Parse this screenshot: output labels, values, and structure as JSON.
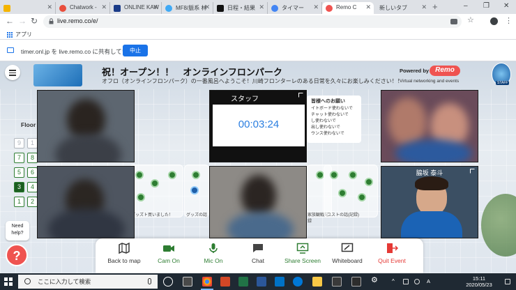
{
  "browser": {
    "tabs": [
      {
        "label": "",
        "favicon_color": "#f4b400"
      },
      {
        "label": "Chatwork - ",
        "favicon_color": "#e94e3c"
      },
      {
        "label": "ONLINE KAW",
        "favicon_color": "#1a3b88"
      },
      {
        "label": "MF8/脈系 林",
        "favicon_color": "#3fa9f5"
      },
      {
        "label": "日程・結果",
        "favicon_color": "#111111"
      },
      {
        "label": "タイマー",
        "favicon_color": "#4285f4"
      },
      {
        "label": "Remo C",
        "favicon_color": "#ef5350"
      },
      {
        "label": "新しいタブ",
        "favicon_color": ""
      }
    ],
    "new_tab_symbol": "+",
    "window_controls": {
      "minimize": "–",
      "maximize": "❐",
      "close": "✕"
    },
    "url": "live.remo.co/e/",
    "bookmarks_apps": "アプリ",
    "share_notice": "timer.onl.jp を live.remo.co に共有しています",
    "stop_share": "中止"
  },
  "remo": {
    "banner_title": "祝！オープン！！　オンラインフロンパーク",
    "banner_subtitle": "オフロ（オンラインフロンパーク）の一番風呂へようこそ！川崎フロンターレのある日常を久々にお楽しみください！！",
    "powered_by": "Powered by",
    "remo_logo": "Remo",
    "remo_tagline": "Virtual networking and events",
    "staff_badge": "STAFF",
    "floor_title": "Floor",
    "floors": [
      "9",
      "1",
      "7",
      "8",
      "5",
      "6",
      "3",
      "4",
      "1",
      "2"
    ],
    "active_floor": "3",
    "need_help": "Need help?",
    "help_symbol": "?",
    "stuff_tile_name": "スタッフ",
    "timer_display": "00:03:24",
    "notice_title": "皆様へのお願い",
    "notice_lines": [
      "イトボード使わないで",
      "チャット使わないで",
      "し使わないで",
      "出し使わないで",
      "ウンス使わないで"
    ],
    "named_tile": "脇坂 泰斗",
    "room_labels": [
      "グッズト買いました！",
      "グッズの話",
      "家族観戦記録",
      "ユストの話(記録)"
    ]
  },
  "controls": [
    {
      "label": "Back to map",
      "icon": "map-icon",
      "color": "#333333"
    },
    {
      "label": "Cam On",
      "icon": "camera-icon",
      "color": "#2e7d32"
    },
    {
      "label": "Mic On",
      "icon": "microphone-icon",
      "color": "#2e7d32"
    },
    {
      "label": "Chat",
      "icon": "chat-icon",
      "color": "#333333"
    },
    {
      "label": "Share Screen",
      "icon": "screen-share-icon",
      "color": "#2e7d32"
    },
    {
      "label": "Whiteboard",
      "icon": "whiteboard-icon",
      "color": "#333333"
    },
    {
      "label": "Quit Event",
      "icon": "exit-icon",
      "color": "#e53935"
    }
  ],
  "taskbar": {
    "search_placeholder": "ここに入力して検索",
    "time": "15:11",
    "date": "2020/05/23",
    "ime": "A"
  }
}
